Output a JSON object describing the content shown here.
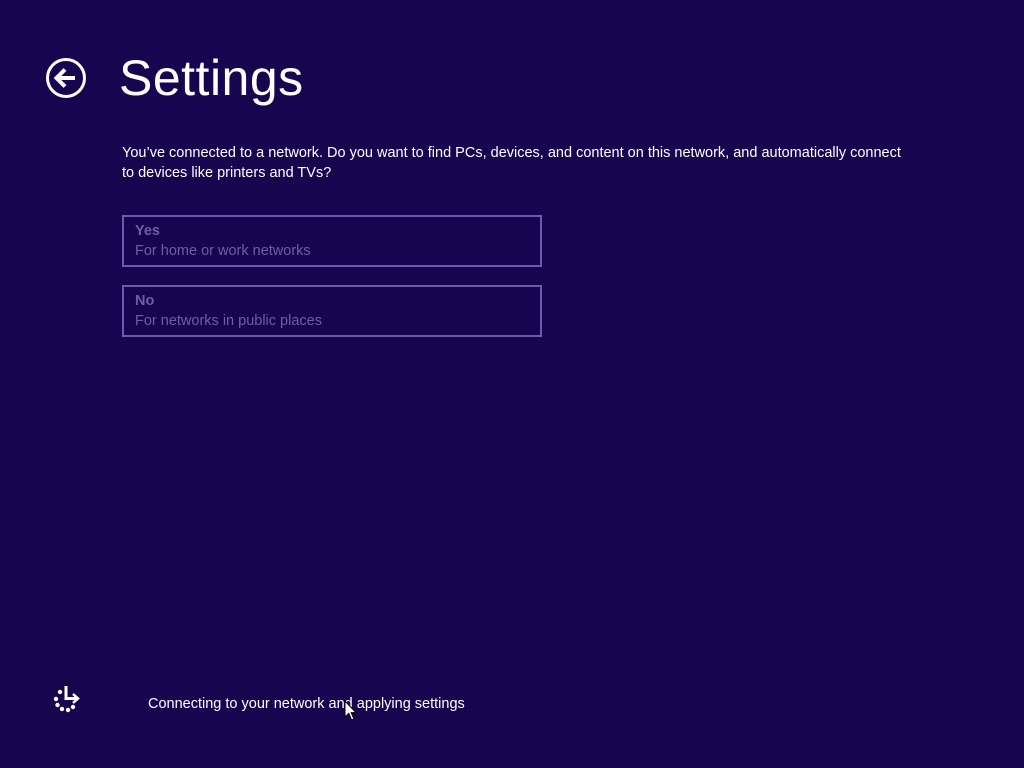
{
  "header": {
    "back_icon": "back-arrow-circle-icon",
    "title": "Settings"
  },
  "prompt": {
    "text": "You’ve connected to a network. Do you want to find PCs, devices, and content on this network, and automatically connect to devices like printers and TVs?"
  },
  "options": [
    {
      "title": "Yes",
      "description": "For home or work networks"
    },
    {
      "title": "No",
      "description": "For networks in public places"
    }
  ],
  "status": {
    "icon": "progress-spinner-icon",
    "text": "Connecting to your network and applying settings"
  },
  "colors": {
    "background": "#180550",
    "text": "#ffffff",
    "option_border": "#6d5aa8",
    "option_text": "#6f5ea6"
  }
}
